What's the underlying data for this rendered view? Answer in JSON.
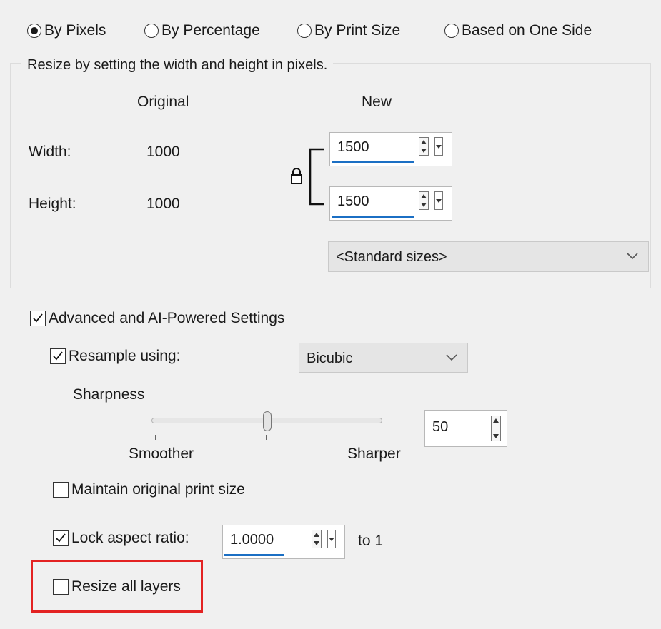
{
  "resize_mode": {
    "options": [
      {
        "label": "By Pixels",
        "selected": true
      },
      {
        "label": "By Percentage",
        "selected": false
      },
      {
        "label": "By Print Size",
        "selected": false
      },
      {
        "label": "Based on One Side",
        "selected": false
      }
    ]
  },
  "pixel_group": {
    "legend": "Resize by setting the width and height in pixels.",
    "col_original": "Original",
    "col_new": "New",
    "width_label": "Width:",
    "height_label": "Height:",
    "width_original": "1000",
    "height_original": "1000",
    "width_new": "1500",
    "height_new": "1500",
    "standard_sizes": "<Standard sizes>"
  },
  "advanced": {
    "label": "Advanced and AI-Powered Settings",
    "checked": true,
    "resample_label": "Resample using:",
    "resample_checked": true,
    "resample_method": "Bicubic",
    "sharpness_label": "Sharpness",
    "smoother_label": "Smoother",
    "sharper_label": "Sharper",
    "sharpness_value": "50",
    "sharpness_level": 50,
    "maintain_print_label": "Maintain original print size",
    "maintain_print_checked": false,
    "lock_aspect_label": "Lock aspect ratio:",
    "lock_aspect_checked": true,
    "aspect_value": "1.0000",
    "aspect_suffix": "to 1",
    "resize_layers_label": "Resize all layers",
    "resize_layers_checked": false
  },
  "icons": {
    "lock": "lock-icon",
    "chevron": "chevron-down-icon",
    "check": "checkmark-icon"
  },
  "colors": {
    "highlight": "#e32222",
    "field_underline": "#1b6fc4"
  }
}
